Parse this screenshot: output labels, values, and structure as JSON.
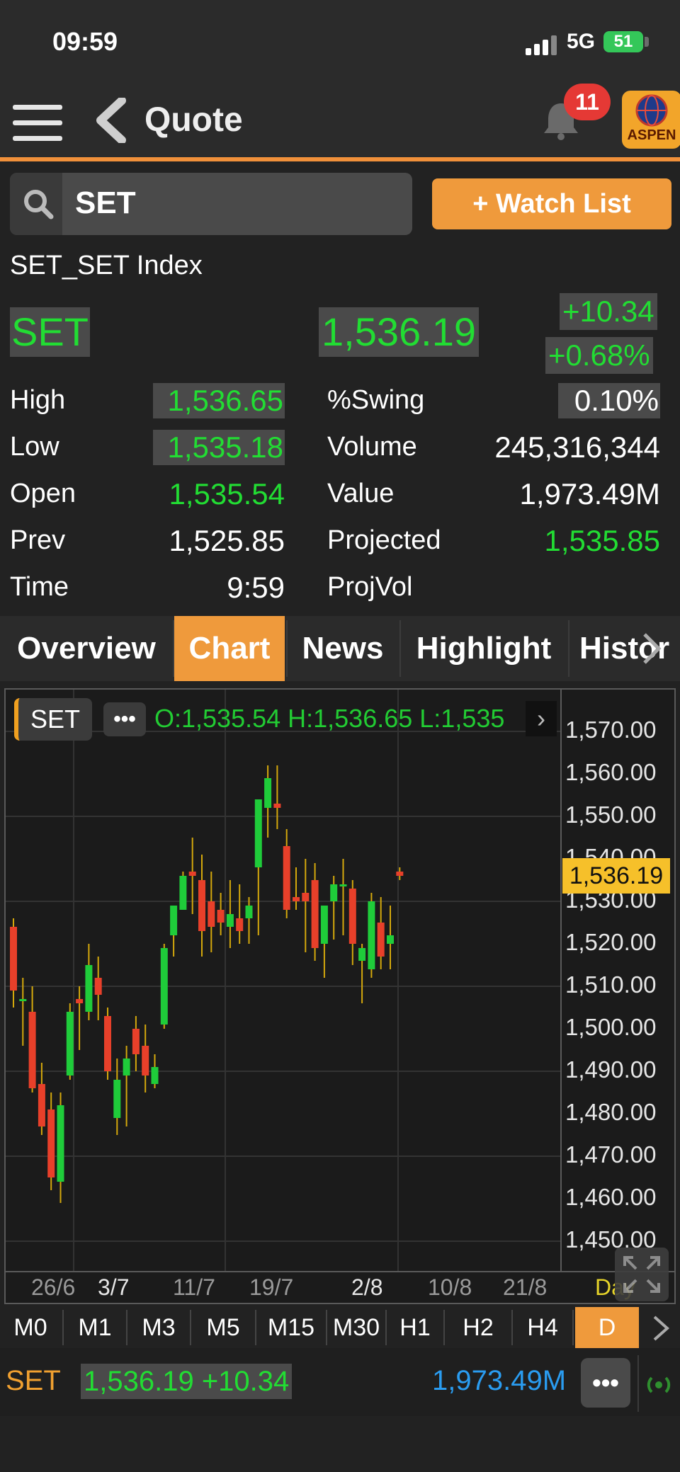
{
  "status": {
    "time": "09:59",
    "network": "5G",
    "battery": "51"
  },
  "header": {
    "title": "Quote",
    "notification_count": "11",
    "logo_text": "ASPEN"
  },
  "search": {
    "value": "SET",
    "watch_button": "+ Watch List"
  },
  "instrument": {
    "name": "SET_SET Index",
    "symbol": "SET",
    "last": "1,536.19",
    "change": "+10.34",
    "change_pct": "+0.68%"
  },
  "stats": {
    "left": [
      {
        "label": "High",
        "value": "1,536.65"
      },
      {
        "label": "Low",
        "value": "1,535.18"
      },
      {
        "label": "Open",
        "value": "1,535.54"
      },
      {
        "label": "Prev",
        "value": "1,525.85"
      },
      {
        "label": "Time",
        "value": "9:59"
      }
    ],
    "right": [
      {
        "label": "%Swing",
        "value": "0.10%"
      },
      {
        "label": "Volume",
        "value": "245,316,344"
      },
      {
        "label": "Value",
        "value": "1,973.49M"
      },
      {
        "label": "Projected",
        "value": "1,535.85"
      },
      {
        "label": "ProjVol",
        "value": ""
      }
    ]
  },
  "tabs": [
    "Overview",
    "Chart",
    "News",
    "Highlight",
    "Histor"
  ],
  "chart": {
    "symbol": "SET",
    "ohlc_text": "O:1,535.54  H:1,536.65  L:1,535",
    "price_tag": "1,536.19",
    "y_labels": [
      "1,570.00",
      "1,560.00",
      "1,550.00",
      "1,540.00",
      "1,530.00",
      "1,520.00",
      "1,510.00",
      "1,500.00",
      "1,490.00",
      "1,480.00",
      "1,470.00",
      "1,460.00",
      "1,450.00"
    ],
    "x_labels": [
      "26/6",
      "3/7",
      "11/7",
      "19/7",
      "2/8",
      "10/8",
      "21/8"
    ],
    "period_label": "Day",
    "colors": {
      "up": "#1fcc3a",
      "down": "#e8402a",
      "wick": "#d4a80c"
    }
  },
  "chart_data": {
    "type": "candlestick",
    "ylim": [
      1450,
      1570
    ],
    "candles": [
      {
        "o": 1524,
        "h": 1526,
        "l": 1505,
        "c": 1509
      },
      {
        "o": 1507,
        "h": 1512,
        "l": 1496,
        "c": 1507
      },
      {
        "o": 1504,
        "h": 1510,
        "l": 1485,
        "c": 1486
      },
      {
        "o": 1487,
        "h": 1492,
        "l": 1475,
        "c": 1477
      },
      {
        "o": 1481,
        "h": 1485,
        "l": 1462,
        "c": 1465
      },
      {
        "o": 1464,
        "h": 1485,
        "l": 1459,
        "c": 1482
      },
      {
        "o": 1489,
        "h": 1506,
        "l": 1488,
        "c": 1504
      },
      {
        "o": 1507,
        "h": 1510,
        "l": 1495,
        "c": 1506
      },
      {
        "o": 1504,
        "h": 1520,
        "l": 1502,
        "c": 1515
      },
      {
        "o": 1512,
        "h": 1517,
        "l": 1502,
        "c": 1508
      },
      {
        "o": 1503,
        "h": 1505,
        "l": 1488,
        "c": 1490
      },
      {
        "o": 1479,
        "h": 1493,
        "l": 1475,
        "c": 1488
      },
      {
        "o": 1489,
        "h": 1496,
        "l": 1477,
        "c": 1493
      },
      {
        "o": 1500,
        "h": 1503,
        "l": 1490,
        "c": 1494
      },
      {
        "o": 1496,
        "h": 1501,
        "l": 1485,
        "c": 1489
      },
      {
        "o": 1487,
        "h": 1494,
        "l": 1486,
        "c": 1491
      },
      {
        "o": 1501,
        "h": 1520,
        "l": 1500,
        "c": 1519
      },
      {
        "o": 1522,
        "h": 1527,
        "l": 1517,
        "c": 1529
      },
      {
        "o": 1528,
        "h": 1537,
        "l": 1528,
        "c": 1536
      },
      {
        "o": 1537,
        "h": 1545,
        "l": 1527,
        "c": 1536
      },
      {
        "o": 1535,
        "h": 1541,
        "l": 1517,
        "c": 1523
      },
      {
        "o": 1530,
        "h": 1537,
        "l": 1518,
        "c": 1524
      },
      {
        "o": 1528,
        "h": 1532,
        "l": 1522,
        "c": 1525
      },
      {
        "o": 1524,
        "h": 1535,
        "l": 1519,
        "c": 1527
      },
      {
        "o": 1526,
        "h": 1534,
        "l": 1520,
        "c": 1523
      },
      {
        "o": 1526,
        "h": 1531,
        "l": 1520,
        "c": 1529
      },
      {
        "o": 1538,
        "h": 1546,
        "l": 1522,
        "c": 1554
      },
      {
        "o": 1552,
        "h": 1562,
        "l": 1545,
        "c": 1559
      },
      {
        "o": 1553,
        "h": 1562,
        "l": 1547,
        "c": 1552
      },
      {
        "o": 1543,
        "h": 1547,
        "l": 1526,
        "c": 1528
      },
      {
        "o": 1531,
        "h": 1538,
        "l": 1528,
        "c": 1530
      },
      {
        "o": 1532,
        "h": 1540,
        "l": 1518,
        "c": 1530
      },
      {
        "o": 1535,
        "h": 1539,
        "l": 1516,
        "c": 1519
      },
      {
        "o": 1520,
        "h": 1528,
        "l": 1512,
        "c": 1529
      },
      {
        "o": 1530,
        "h": 1536,
        "l": 1521,
        "c": 1534
      },
      {
        "o": 1534,
        "h": 1540,
        "l": 1522,
        "c": 1534
      },
      {
        "o": 1533,
        "h": 1535,
        "l": 1515,
        "c": 1520
      },
      {
        "o": 1516,
        "h": 1520,
        "l": 1506,
        "c": 1519
      },
      {
        "o": 1514,
        "h": 1532,
        "l": 1512,
        "c": 1530
      },
      {
        "o": 1525,
        "h": 1531,
        "l": 1514,
        "c": 1517
      },
      {
        "o": 1520,
        "h": 1529,
        "l": 1514,
        "c": 1522
      },
      {
        "o": 1537,
        "h": 1538,
        "l": 1535,
        "c": 1536
      }
    ]
  },
  "timeframes": [
    "M0",
    "M1",
    "M3",
    "M5",
    "M15",
    "M30",
    "H1",
    "H2",
    "H4",
    "D"
  ],
  "ticker": {
    "symbol": "SET",
    "quote": "1,536.19 +10.34",
    "value": "1,973.49M"
  }
}
